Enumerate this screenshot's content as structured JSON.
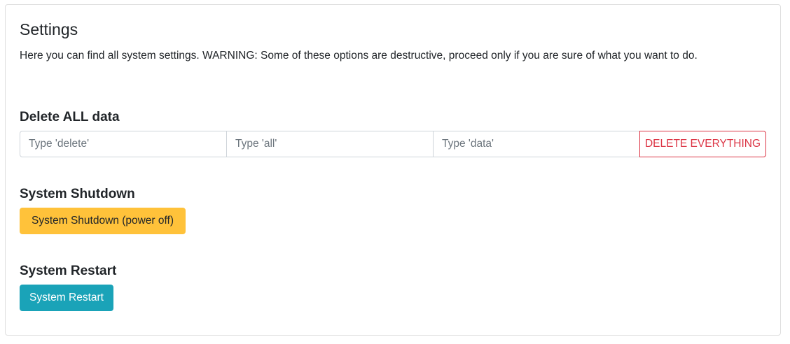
{
  "settings": {
    "title": "Settings",
    "description": "Here you can find all system settings. WARNING: Some of these options are destructive, proceed only if you are sure of what you want to do."
  },
  "delete_all": {
    "title": "Delete ALL data",
    "input1_placeholder": "Type 'delete'",
    "input2_placeholder": "Type 'all'",
    "input3_placeholder": "Type 'data'",
    "button_label": "DELETE EVERYTHING",
    "button_color": "#dc3545"
  },
  "shutdown": {
    "title": "System Shutdown",
    "button_label": "System Shutdown (power off)",
    "button_color": "#ffc23a"
  },
  "restart": {
    "title": "System Restart",
    "button_label": "System Restart",
    "button_color": "#1aa3b8"
  }
}
